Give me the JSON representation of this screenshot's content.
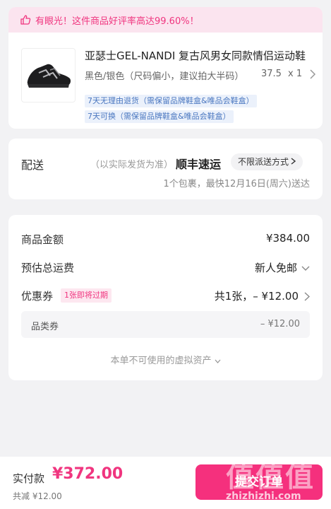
{
  "product_card": {
    "praise_text": "有眼光！这件商品好评率高达99.60%！",
    "title": "亚瑟士GEL-NANDI 复古风男女同款情侣运动鞋",
    "spec": "黑色/银色（尺码偏小，建议拍大半码）",
    "size": "37.5",
    "quantity": "x 1",
    "return_policy": "7天无理由退货（需保留品牌鞋盒&唯品会鞋盒）",
    "exchange_policy": "7天可换（需保留品牌鞋盒&唯品会鞋盒）"
  },
  "delivery": {
    "label": "配送",
    "note": "（以实际发货为准）",
    "carrier": "顺丰速运",
    "method": "不限派送方式",
    "eta": "1个包裹，最快12月16日(周六)送达"
  },
  "pricing": {
    "goods_label": "商品金额",
    "goods_value": "¥384.00",
    "shipping_label": "预估总运费",
    "shipping_value": "新人免邮",
    "coupon_label": "优惠券",
    "coupon_badge": "1张即将过期",
    "coupon_value": "共1张，– ¥12.00",
    "category_coupon_label": "品类券",
    "category_coupon_value": "– ¥12.00",
    "virtual_assets_text": "本单不可使用的虚拟资产"
  },
  "bottom_bar": {
    "pay_label": "实付款",
    "pay_amount": "¥372.00",
    "discount_text": "共减 ¥12.00",
    "submit_label": "提交订单"
  },
  "watermark": {
    "chars": "值值值",
    "site": "zhizhizhi.com"
  },
  "colors": {
    "accent": "#f0357f",
    "praise_bg": "#fbe4ef",
    "tag_text": "#4a77c0",
    "tag_bg": "#ebf1fb",
    "page_bg": "#f2f2f4"
  }
}
